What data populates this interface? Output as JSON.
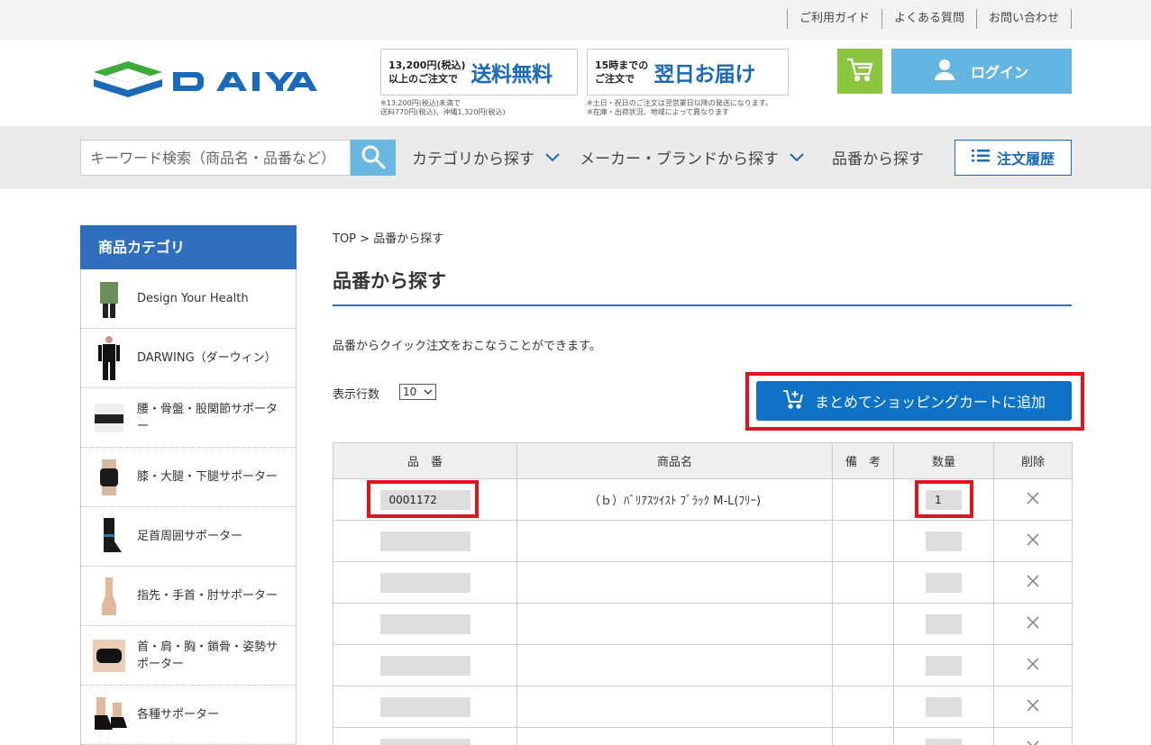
{
  "util_links": [
    "ご利用ガイド",
    "よくある質問",
    "お問い合わせ"
  ],
  "promo": {
    "shipping": {
      "line1": "13,200円(税込)",
      "line2": "以上のご注文で",
      "big": "送料無料",
      "note1": "※13,200円(税込)未満で",
      "note2": "送料770円(税込)、沖縄1,320円(税込)"
    },
    "nextday": {
      "line1": "15時までの",
      "line2": "ご注文で",
      "big": "翌日お届け",
      "note1": "※土日・祝日のご注文は翌営業日以降の発送になります。",
      "note2": "※在庫・出荷状況、地域によって異なります"
    }
  },
  "login_label": "ログイン",
  "search": {
    "placeholder": "キーワード検索（商品名・品番など）"
  },
  "nav": {
    "category": "カテゴリから探す",
    "maker": "メーカー・ブランドから探す",
    "partno": "品番から探す",
    "history": "注文履歴"
  },
  "sidebar": {
    "title": "商品カテゴリ",
    "items": [
      {
        "label": "Design Your Health"
      },
      {
        "label": "DARWING（ダーウィン）"
      },
      {
        "label": "腰・骨盤・股関節サポーター"
      },
      {
        "label": "膝・大腿・下腿サポーター"
      },
      {
        "label": "足首周囲サポーター"
      },
      {
        "label": "指先・手首・肘サポーター"
      },
      {
        "label": "首・肩・胸・鎖骨・姿勢サポーター"
      },
      {
        "label": "各種サポーター"
      }
    ]
  },
  "breadcrumb": {
    "top": "TOP",
    "sep": ">",
    "current": "品番から探す"
  },
  "page_title": "品番から探す",
  "description": "品番からクイック注文をおこなうことができます。",
  "rows_label": "表示行数",
  "rows_value": "10",
  "add_to_cart_label": "まとめてショッピングカートに追加",
  "table": {
    "headers": [
      "品　番",
      "商品名",
      "備　考",
      "数量",
      "削除"
    ],
    "rows": [
      {
        "code": "0001172",
        "name": "（ｂ）ﾊﾞﾘｱｽﾂｲｽﾄ ﾌﾞﾗｯｸ M-L(ﾌﾘｰ)",
        "note": "",
        "qty": "1"
      },
      {
        "code": "",
        "name": "",
        "note": "",
        "qty": ""
      },
      {
        "code": "",
        "name": "",
        "note": "",
        "qty": ""
      },
      {
        "code": "",
        "name": "",
        "note": "",
        "qty": ""
      },
      {
        "code": "",
        "name": "",
        "note": "",
        "qty": ""
      },
      {
        "code": "",
        "name": "",
        "note": "",
        "qty": ""
      },
      {
        "code": "",
        "name": "",
        "note": "",
        "qty": ""
      }
    ]
  },
  "colors": {
    "brand_blue": "#2f6fbd",
    "button_blue": "#0e72c7",
    "cart_green": "#8cc63f",
    "login_blue": "#64b5e0",
    "highlight_red": "#e0141e"
  }
}
